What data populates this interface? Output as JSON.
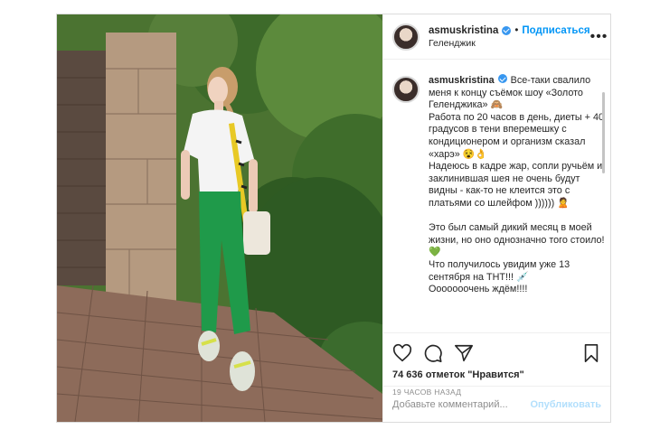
{
  "post": {
    "username": "asmuskristina",
    "follow_label": "Подписаться",
    "location": "Геленджик",
    "more_label": "•••"
  },
  "caption": {
    "username": "asmuskristina",
    "text": "Все-таки свалило меня к концу съёмок шоу «Золото Геленджика» 🙈\nРабота по 20 часов в день, диеты + 40 градусов в тени вперемешку с кондиционером и организм сказал «харэ» 😵👌\nНадеюсь в кадре жар, сопли ручьём и заклинившая шея не очень будут видны - как-то не клеится это с платьями со шлейфом )))))) 🙎\n\nЭто был самый дикий месяц в моей жизни, но оно однозначно того стоило! 💚\nЧто получилось увидим уже 13 сентября на ТНТ!!! 💉\nОоооооочень ждём!!!!"
  },
  "actions": {
    "icons": [
      "heart-icon",
      "comment-icon",
      "share-icon",
      "bookmark-icon"
    ],
    "likes_count": "74 636 отметок",
    "likes_suffix": "\"Нравится\"",
    "time_ago": "19 ЧАСОВ НАЗАД"
  },
  "comment": {
    "placeholder": "Добавьте комментарий...",
    "publish_label": "Опубликовать"
  }
}
